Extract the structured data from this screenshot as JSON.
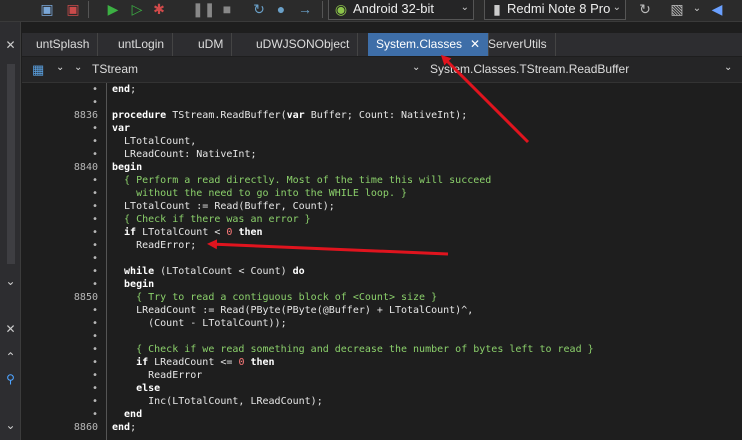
{
  "toolbar": {
    "platform_combo": "Android 32-bit",
    "device_combo": "Redmi Note 8 Pro"
  },
  "tabs": [
    {
      "label": "untSplash"
    },
    {
      "label": "untLogin"
    },
    {
      "label": "uDM"
    },
    {
      "label": "uDWJSONObject"
    },
    {
      "label": "System.Classes",
      "active": true
    },
    {
      "label": "ServerUtils"
    }
  ],
  "secondbar": {
    "class_combo": "TStream",
    "method_combo": "System.Classes.TStream.ReadBuffer"
  },
  "code_lines": [
    {
      "ln": "•",
      "parts": [
        [
          "kw",
          "end"
        ],
        [
          "txt",
          ";"
        ]
      ]
    },
    {
      "ln": "•",
      "parts": []
    },
    {
      "ln": "8836",
      "parts": [
        [
          "kw",
          "procedure"
        ],
        [
          "txt",
          " TStream.ReadBuffer("
        ],
        [
          "kw",
          "var"
        ],
        [
          "txt",
          " Buffer; Count: NativeInt);"
        ]
      ]
    },
    {
      "ln": "•",
      "parts": [
        [
          "kw",
          "var"
        ]
      ]
    },
    {
      "ln": "•",
      "parts": [
        [
          "txt",
          "  LTotalCount,"
        ]
      ]
    },
    {
      "ln": "•",
      "parts": [
        [
          "txt",
          "  LReadCount: NativeInt;"
        ]
      ]
    },
    {
      "ln": "8840",
      "parts": [
        [
          "kw",
          "begin"
        ]
      ]
    },
    {
      "ln": "•",
      "parts": [
        [
          "cm",
          "  { Perform a read directly. Most of the time this will succeed"
        ]
      ]
    },
    {
      "ln": "•",
      "parts": [
        [
          "cm",
          "    without the need to go into the WHILE loop. }"
        ]
      ]
    },
    {
      "ln": "•",
      "parts": [
        [
          "txt",
          "  LTotalCount := Read(Buffer, Count);"
        ]
      ]
    },
    {
      "ln": "•",
      "parts": [
        [
          "cm",
          "  { Check if there was an error }"
        ]
      ]
    },
    {
      "ln": "•",
      "parts": [
        [
          "kw",
          "  if"
        ],
        [
          "txt",
          " LTotalCount < "
        ],
        [
          "num",
          "0"
        ],
        [
          "kw",
          " then"
        ]
      ]
    },
    {
      "ln": "•",
      "parts": [
        [
          "txt",
          "    ReadError;"
        ]
      ]
    },
    {
      "ln": "•",
      "parts": []
    },
    {
      "ln": "•",
      "parts": [
        [
          "kw",
          "  while"
        ],
        [
          "txt",
          " (LTotalCount < Count) "
        ],
        [
          "kw",
          "do"
        ]
      ]
    },
    {
      "ln": "•",
      "parts": [
        [
          "kw",
          "  begin"
        ]
      ]
    },
    {
      "ln": "8850",
      "parts": [
        [
          "cm",
          "    { Try to read a contiguous block of <Count> size }"
        ]
      ]
    },
    {
      "ln": "•",
      "parts": [
        [
          "txt",
          "    LReadCount := Read(PByte(PByte(@Buffer) + LTotalCount)^,"
        ]
      ]
    },
    {
      "ln": "•",
      "parts": [
        [
          "txt",
          "      (Count - LTotalCount));"
        ]
      ]
    },
    {
      "ln": "•",
      "parts": []
    },
    {
      "ln": "•",
      "parts": [
        [
          "cm",
          "    { Check if we read something and decrease the number of bytes left to read }"
        ]
      ]
    },
    {
      "ln": "•",
      "parts": [
        [
          "kw",
          "    if"
        ],
        [
          "txt",
          " LReadCount <= "
        ],
        [
          "num",
          "0"
        ],
        [
          "kw",
          " then"
        ]
      ]
    },
    {
      "ln": "•",
      "parts": [
        [
          "txt",
          "      ReadError"
        ]
      ]
    },
    {
      "ln": "•",
      "parts": [
        [
          "kw",
          "    else"
        ]
      ]
    },
    {
      "ln": "•",
      "parts": [
        [
          "txt",
          "      Inc(LTotalCount, LReadCount);"
        ]
      ]
    },
    {
      "ln": "•",
      "parts": [
        [
          "kw",
          "  end"
        ]
      ]
    },
    {
      "ln": "8860",
      "parts": [
        [
          "kw",
          "end"
        ],
        [
          "txt",
          ";"
        ]
      ]
    }
  ],
  "annotation_color": "#e0141e"
}
